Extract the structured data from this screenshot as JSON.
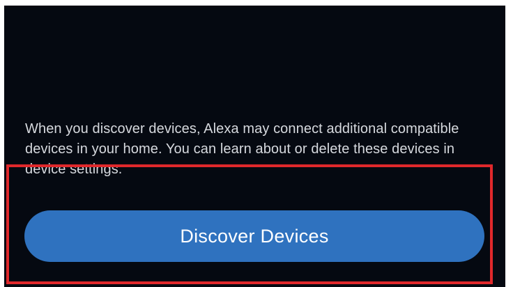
{
  "info": {
    "text": "When you discover devices, Alexa may connect additional compatible devices in your home. You can learn about or delete these devices in device settings."
  },
  "actions": {
    "discover_label": "Discover Devices"
  },
  "colors": {
    "background": "#050911",
    "button": "#2f72bf",
    "highlight": "#e0282b"
  }
}
